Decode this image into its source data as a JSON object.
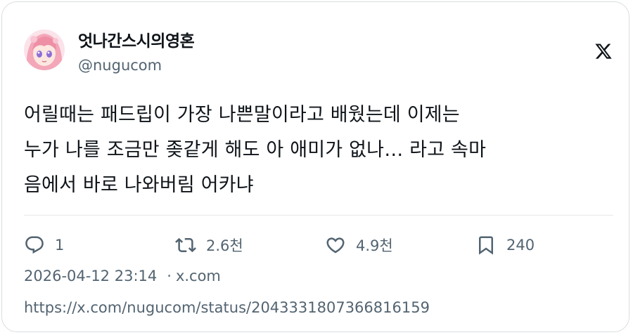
{
  "author": {
    "display_name": "엇나간스시의영혼",
    "handle": "@nugucom"
  },
  "brand": {
    "icon": "x-logo-icon"
  },
  "tweet": {
    "lines": [
      "어릴때는 패드립이 가장 나쁜말이라고 배웠는데 이제는",
      "누가 나를 조금만 좆같게 해도 아 애미가 없나… 라고 속마",
      "음에서 바로 나와버림 어카냐"
    ]
  },
  "actions": {
    "reply": {
      "icon": "reply-icon",
      "count": "1"
    },
    "retweet": {
      "icon": "retweet-icon",
      "count": "2.6천"
    },
    "like": {
      "icon": "heart-icon",
      "count": "4.9천"
    },
    "bookmark": {
      "icon": "bookmark-icon",
      "count": "240"
    }
  },
  "meta": {
    "timestamp": "2026-04-12 23:14",
    "separator": "·",
    "source": "x.com"
  },
  "url": "https://x.com/nugucom/status/2043331807366816159",
  "colors": {
    "text": "#0f1419",
    "secondary": "#536471",
    "border": "#d9dde0",
    "avatar_hair": "#f3a7b8"
  }
}
